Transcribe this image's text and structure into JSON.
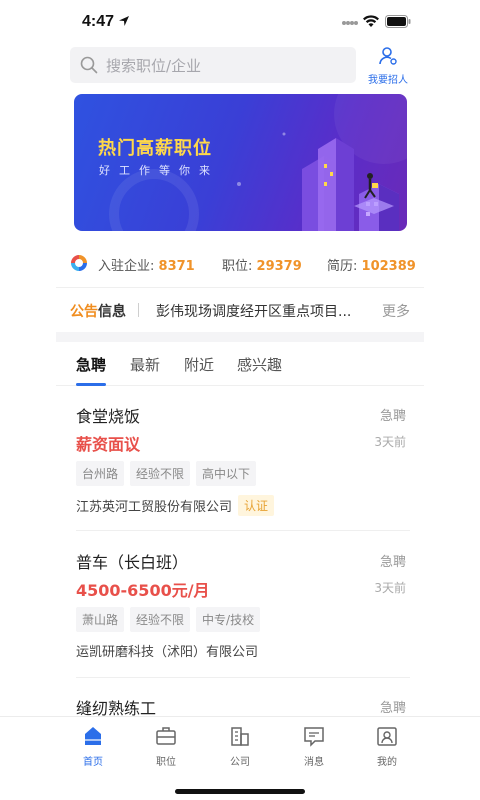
{
  "status_bar": {
    "time": "4:47"
  },
  "search": {
    "placeholder": "搜索职位/企业"
  },
  "recruit": {
    "label": "我要招人"
  },
  "banner": {
    "title": "热门高薪职位",
    "subtitle": "好工作等你来"
  },
  "stats": {
    "companies_label": "入驻企业:",
    "companies_value": "8371",
    "jobs_label": "职位:",
    "jobs_value": "29379",
    "resumes_label": "简历:",
    "resumes_value": "102389"
  },
  "notice": {
    "badge_a": "公告",
    "badge_b": "信息",
    "text": "彭伟现场调度经开区重点项目...",
    "more": "更多"
  },
  "tabs": [
    {
      "label": "急聘"
    },
    {
      "label": "最新"
    },
    {
      "label": "附近"
    },
    {
      "label": "感兴趣"
    }
  ],
  "jobs": [
    {
      "title": "食堂烧饭",
      "tag": "急聘",
      "salary": "薪资面议",
      "time": "3天前",
      "reqs": [
        "台州路",
        "经验不限",
        "高中以下"
      ],
      "company": "江苏英河工贸股份有限公司",
      "cert": "认证"
    },
    {
      "title": "普车（长白班）",
      "tag": "急聘",
      "salary": "4500-6500元/月",
      "time": "3天前",
      "reqs": [
        "萧山路",
        "经验不限",
        "中专/技校"
      ],
      "company": "运凯研磨科技（沭阳）有限公司"
    },
    {
      "title": "缝纫熟练工",
      "tag": "急聘"
    }
  ],
  "bottom_nav": [
    {
      "label": "首页",
      "icon": "home-icon"
    },
    {
      "label": "职位",
      "icon": "briefcase-icon"
    },
    {
      "label": "公司",
      "icon": "building-icon"
    },
    {
      "label": "消息",
      "icon": "message-icon"
    },
    {
      "label": "我的",
      "icon": "profile-icon"
    }
  ],
  "colors": {
    "accent": "#2b6ee9",
    "salary": "#e8504a",
    "stat_number": "#f0932a"
  }
}
